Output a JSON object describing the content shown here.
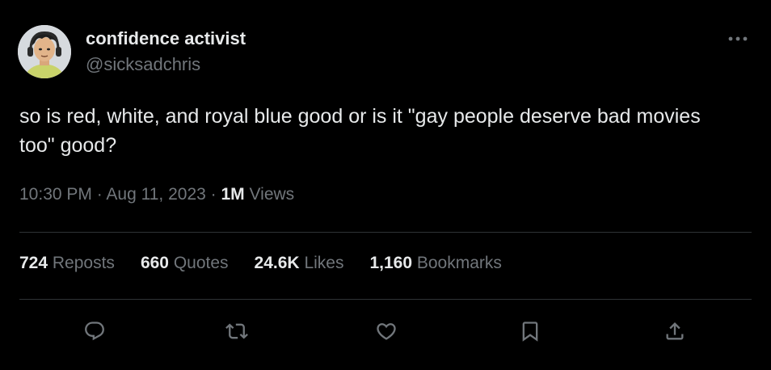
{
  "author": {
    "name": "confidence activist",
    "handle": "@sicksadchris",
    "avatar_icon": "avatar-illustration"
  },
  "tweet": {
    "text": "so is red, white, and royal blue good or is it \"gay people deserve bad movies too\" good?",
    "time": "10:30 PM",
    "separator": "·",
    "date": "Aug 11, 2023",
    "views_count": "1M",
    "views_label": "Views"
  },
  "stats": [
    {
      "count": "724",
      "label": "Reposts"
    },
    {
      "count": "660",
      "label": "Quotes"
    },
    {
      "count": "24.6K",
      "label": "Likes"
    },
    {
      "count": "1,160",
      "label": "Bookmarks"
    }
  ],
  "actions": [
    {
      "icon": "reply-icon"
    },
    {
      "icon": "repost-icon"
    },
    {
      "icon": "like-icon"
    },
    {
      "icon": "bookmark-icon"
    },
    {
      "icon": "share-icon"
    }
  ],
  "colors": {
    "background": "#000000",
    "primary_text": "#e7e9ea",
    "secondary_text": "#71767b",
    "divider": "#2f3336"
  }
}
